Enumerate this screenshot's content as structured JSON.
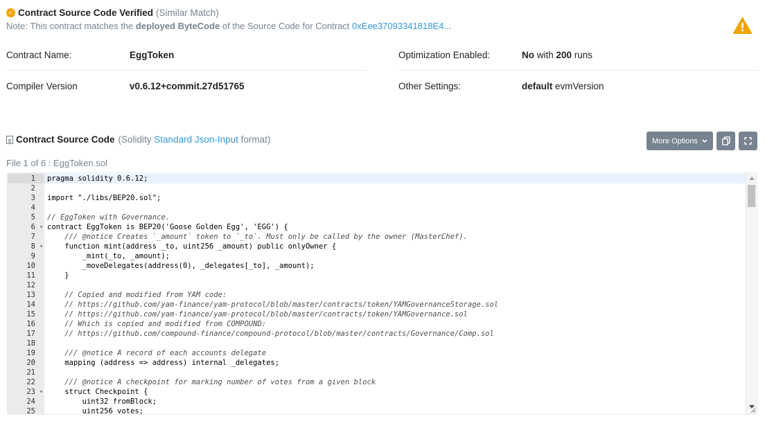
{
  "verified": {
    "title": "Contract Source Code Verified",
    "similar": "(Similar Match)",
    "note_prefix": "Note: This contract matches the ",
    "note_bold": "deployed ByteCode",
    "note_middle": " of the Source Code for Contract ",
    "note_link": "0xEee37093341818E4..."
  },
  "info": {
    "contract_name_label": "Contract Name:",
    "contract_name_value": "EggToken",
    "compiler_label": "Compiler Version",
    "compiler_value": "v0.6.12+commit.27d51765",
    "optimization_label": "Optimization Enabled:",
    "optimization_no": "No",
    "optimization_with": " with ",
    "optimization_runs": "200",
    "optimization_runs_suffix": " runs",
    "other_label": "Other Settings:",
    "other_bold": "default",
    "other_rest": " evmVersion"
  },
  "source": {
    "title": "Contract Source Code",
    "sub_prefix": "(Solidity ",
    "sub_link": "Standard Json-Input",
    "sub_suffix": " format)",
    "file_label": "File 1 of 6 : EggToken.sol",
    "more_options": "More Options"
  },
  "code_lines": [
    {
      "n": "1",
      "t": "pragma solidity 0.6.12;",
      "c": "plain"
    },
    {
      "n": "2",
      "t": "",
      "c": "plain"
    },
    {
      "n": "3",
      "t": "import \"./libs/BEP20.sol\";",
      "c": "plain"
    },
    {
      "n": "4",
      "t": "",
      "c": "plain"
    },
    {
      "n": "5",
      "t": "// EggToken with Governance.",
      "c": "comment"
    },
    {
      "n": "6",
      "t": "contract EggToken is BEP20('Goose Golden Egg', 'EGG') {",
      "c": "plain",
      "fold": true
    },
    {
      "n": "7",
      "t": "    /// @notice Creates `_amount` token to `_to`. Must only be called by the owner (MasterChef).",
      "c": "comment"
    },
    {
      "n": "8",
      "t": "    function mint(address _to, uint256 _amount) public onlyOwner {",
      "c": "plain",
      "fold": true
    },
    {
      "n": "9",
      "t": "        _mint(_to, _amount);",
      "c": "plain"
    },
    {
      "n": "10",
      "t": "        _moveDelegates(address(0), _delegates[_to], _amount);",
      "c": "plain"
    },
    {
      "n": "11",
      "t": "    }",
      "c": "plain"
    },
    {
      "n": "12",
      "t": "",
      "c": "plain"
    },
    {
      "n": "13",
      "t": "    // Copied and modified from YAM code:",
      "c": "comment"
    },
    {
      "n": "14",
      "t": "    // https://github.com/yam-finance/yam-protocol/blob/master/contracts/token/YAMGovernanceStorage.sol",
      "c": "comment"
    },
    {
      "n": "15",
      "t": "    // https://github.com/yam-finance/yam-protocol/blob/master/contracts/token/YAMGovernance.sol",
      "c": "comment"
    },
    {
      "n": "16",
      "t": "    // Which is copied and modified from COMPOUND:",
      "c": "comment"
    },
    {
      "n": "17",
      "t": "    // https://github.com/compound-finance/compound-protocol/blob/master/contracts/Governance/Comp.sol",
      "c": "comment"
    },
    {
      "n": "18",
      "t": "",
      "c": "plain"
    },
    {
      "n": "19",
      "t": "    /// @notice A record of each accounts delegate",
      "c": "comment"
    },
    {
      "n": "20",
      "t": "    mapping (address => address) internal _delegates;",
      "c": "plain"
    },
    {
      "n": "21",
      "t": "",
      "c": "plain"
    },
    {
      "n": "22",
      "t": "    /// @notice A checkpoint for marking number of votes from a given block",
      "c": "comment"
    },
    {
      "n": "23",
      "t": "    struct Checkpoint {",
      "c": "plain",
      "fold": true
    },
    {
      "n": "24",
      "t": "        uint32 fromBlock;",
      "c": "plain"
    },
    {
      "n": "25",
      "t": "        uint256 votes;",
      "c": "plain"
    }
  ],
  "colors": {
    "link": "#3498db",
    "muted": "#77838f",
    "warning": "#f0a400",
    "button": "#77838f"
  }
}
